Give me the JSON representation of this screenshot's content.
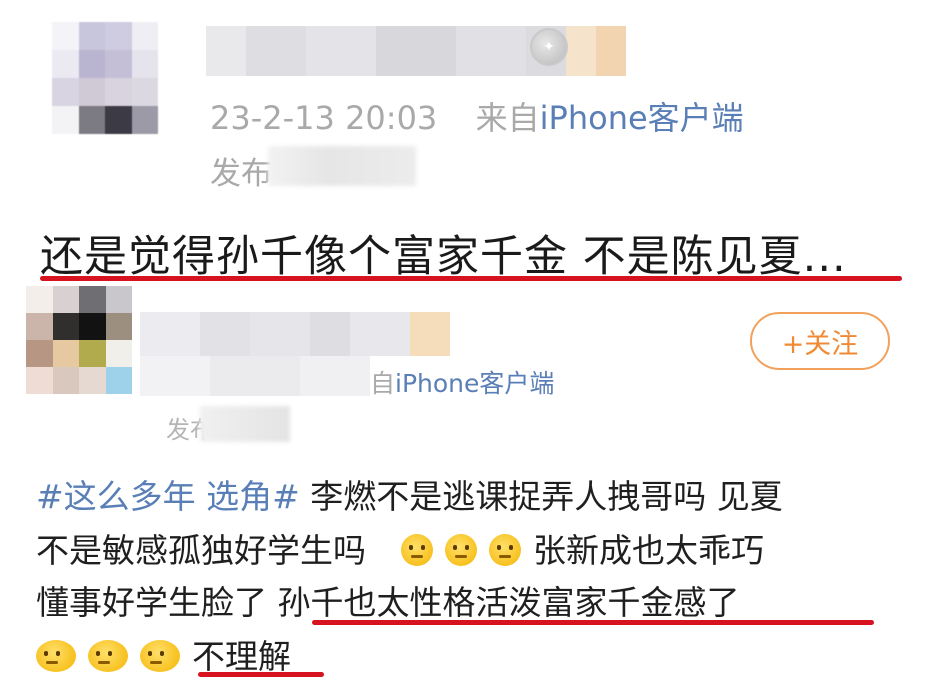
{
  "post1": {
    "timestamp": "23-2-13 20:03",
    "source_prefix": "来自",
    "source": "iPhone客户端",
    "publish_label": "发布",
    "headline": "还是觉得孙千像个富家千金 不是陈见夏..."
  },
  "post2": {
    "source_prefix": "自",
    "source": "iPhone客户端",
    "publish_label": "发布",
    "follow_label": "+关注",
    "tag1": "#这么多年 选角#",
    "line1_text": " 李燃不是逃课捉弄人拽哥吗 见夏",
    "line2_text": "不是敏感孤独好学生吗",
    "line2_text_b": "张新成也太乖巧",
    "line3_text": "懂事好学生脸了 ",
    "line3_highlight": "孙千也太性格活泼富家千金感了",
    "line4_text": "不理解"
  },
  "colors": {
    "link": "#5a7fb6",
    "follow_orange": "#f08a35",
    "underline_red": "#d6131e"
  },
  "icons": [
    "medal-icon",
    "grimace-emoji-icon",
    "shrug-emoji-icon"
  ]
}
